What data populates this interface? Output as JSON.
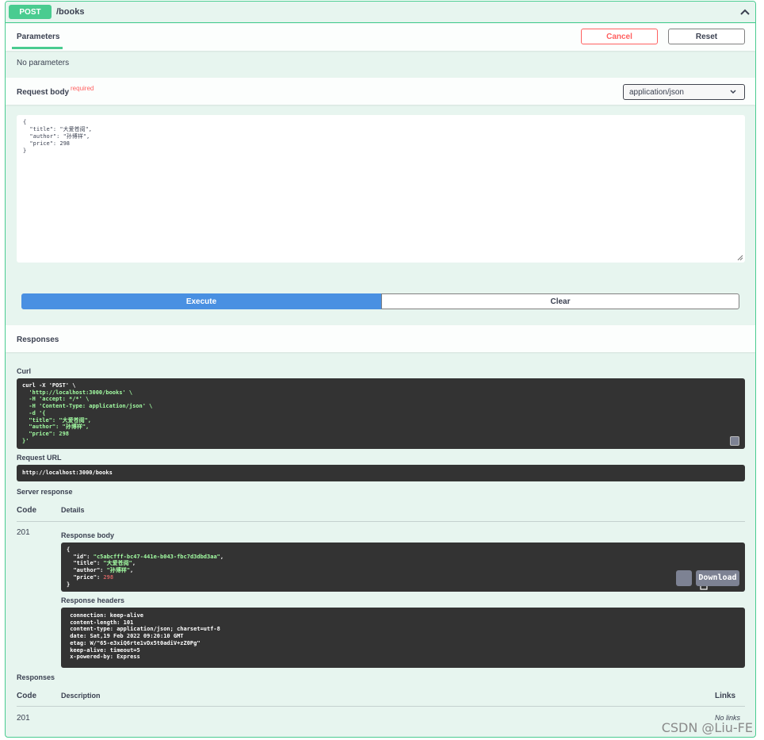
{
  "operation": {
    "method": "POST",
    "path": "/books"
  },
  "tabs": {
    "parameters": "Parameters",
    "cancel": "Cancel",
    "reset": "Reset",
    "no_parameters": "No parameters"
  },
  "request_body": {
    "label": "Request body",
    "required": "required",
    "content_type": "application/json",
    "lines": [
      "{",
      "  \"title\": \"大爱苍阅\",",
      "  \"author\": \"孙博祥\",",
      "  \"price\": 298",
      "}"
    ]
  },
  "actions": {
    "execute": "Execute",
    "clear": "Clear"
  },
  "responses_section": {
    "title": "Responses",
    "curl_label": "Curl",
    "curl_lines": [
      "curl -X 'POST' \\",
      "  'http://localhost:3000/books' \\",
      "  -H 'accept: */*' \\",
      "  -H 'Content-Type: application/json' \\",
      "  -d '{",
      "  \"title\": \"大爱苍阅\",",
      "  \"author\": \"孙博祥\",",
      "  \"price\": 298",
      "}'"
    ],
    "request_url_label": "Request URL",
    "request_url": "http://localhost:3000/books",
    "server_response_label": "Server response",
    "code_header": "Code",
    "details_header": "Details",
    "status_code": "201",
    "response_body_label": "Response body",
    "response_body": {
      "id_key": "\"id\"",
      "id_value": "\"c5abcfff-bc47-441e-b043-fbc7d3dbd3aa\"",
      "title_key": "\"title\"",
      "title_value": "\"大爱苍阅\"",
      "author_key": "\"author\"",
      "author_value": "\"孙博祥\"",
      "price_key": "\"price\"",
      "price_value": "298"
    },
    "download": "Download",
    "response_headers_label": "Response headers",
    "response_headers": [
      " connection: keep-alive ",
      " content-length: 101 ",
      " content-type: application/json; charset=utf-8 ",
      " date: Sat,19 Feb 2022 09:20:10 GMT ",
      " etag: W/\"65-e3xiQ6rte1vDx5t0adiV+zZ0Pg\" ",
      " keep-alive: timeout=5 ",
      " x-powered-by: Express "
    ]
  },
  "responses_table": {
    "title": "Responses",
    "code_header": "Code",
    "description_header": "Description",
    "links_header": "Links",
    "code": "201",
    "links_value": "No links"
  },
  "watermark": "CSDN @Liu-FE",
  "colors": {
    "post_green": "#49cc90",
    "execute_blue": "#4990e2",
    "cancel_red": "#ff6060",
    "code_bg": "#333333"
  }
}
